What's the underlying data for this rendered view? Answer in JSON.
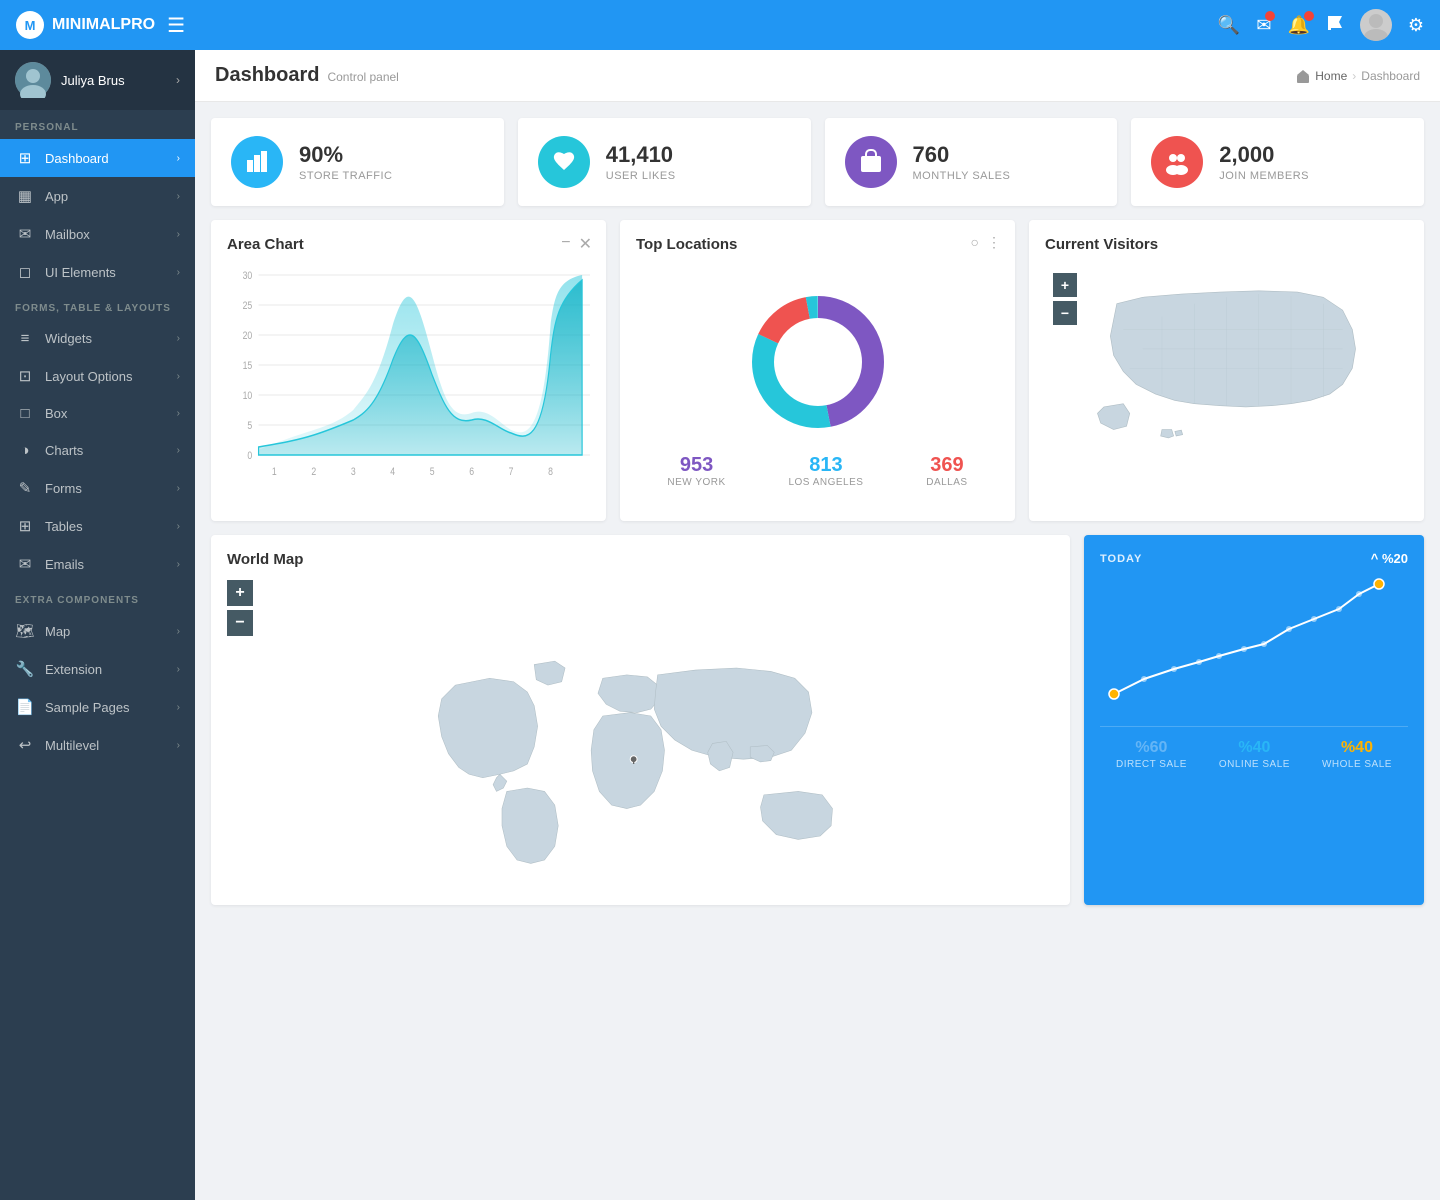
{
  "app": {
    "name": "MINIMALPRO",
    "hamburger": "☰"
  },
  "topnav": {
    "search_icon": "🔍",
    "mail_icon": "✉",
    "bell_icon": "🔔",
    "flag_icon": "⚑",
    "settings_icon": "⚙"
  },
  "sidebar": {
    "user_name": "Juliya Brus",
    "sections": [
      {
        "label": "PERSONAL",
        "items": [
          {
            "icon": "⊞",
            "label": "Dashboard",
            "active": true
          },
          {
            "icon": "▦",
            "label": "App",
            "active": false
          },
          {
            "icon": "✉",
            "label": "Mailbox",
            "active": false
          },
          {
            "icon": "◻",
            "label": "UI Elements",
            "active": false
          }
        ]
      },
      {
        "label": "FORMS, TABLE & LAYOUTS",
        "items": [
          {
            "icon": "≡",
            "label": "Widgets",
            "active": false
          },
          {
            "icon": "⊡",
            "label": "Layout Options",
            "active": false
          },
          {
            "icon": "□",
            "label": "Box",
            "active": false
          },
          {
            "icon": "◑",
            "label": "Charts",
            "active": false
          },
          {
            "icon": "✎",
            "label": "Forms",
            "active": false
          },
          {
            "icon": "⊞",
            "label": "Tables",
            "active": false
          },
          {
            "icon": "✉",
            "label": "Emails",
            "active": false
          }
        ]
      },
      {
        "label": "EXTRA COMPONENTS",
        "items": [
          {
            "icon": "🗺",
            "label": "Map",
            "active": false
          },
          {
            "icon": "🔧",
            "label": "Extension",
            "active": false
          },
          {
            "icon": "📄",
            "label": "Sample Pages",
            "active": false
          },
          {
            "icon": "↩",
            "label": "Multilevel",
            "active": false
          }
        ]
      }
    ]
  },
  "page_header": {
    "title": "Dashboard",
    "subtitle": "Control panel",
    "breadcrumb_home": "Home",
    "breadcrumb_current": "Dashboard"
  },
  "stats": [
    {
      "id": "traffic",
      "value": "90%",
      "label": "STORE TRAFFIC",
      "color": "#29b6f6",
      "icon": "📊"
    },
    {
      "id": "likes",
      "value": "41,410",
      "label": "USER LIKES",
      "color": "#26c6da",
      "icon": "👍"
    },
    {
      "id": "sales",
      "value": "760",
      "label": "MONTHLY SALES",
      "color": "#7e57c2",
      "icon": "🛒"
    },
    {
      "id": "members",
      "value": "2,000",
      "label": "JOIN MEMBERS",
      "color": "#ef5350",
      "icon": "👥"
    }
  ],
  "area_chart": {
    "title": "Area Chart",
    "y_labels": [
      "30",
      "25",
      "20",
      "15",
      "10",
      "5",
      "0"
    ],
    "x_labels": [
      "1",
      "2",
      "3",
      "4",
      "5",
      "6",
      "7",
      "8"
    ]
  },
  "top_locations": {
    "title": "Top Locations",
    "locations": [
      {
        "city": "New York",
        "value": "953",
        "color": "#7e57c2"
      },
      {
        "city": "Los Angeles",
        "value": "813",
        "color": "#29b6f6"
      },
      {
        "city": "Dallas",
        "value": "369",
        "color": "#ef5350"
      }
    ],
    "donut_segments": [
      {
        "label": "New York",
        "color": "#7e57c2",
        "percent": 47
      },
      {
        "label": "Los Angeles",
        "color": "#26c6da",
        "percent": 35
      },
      {
        "label": "Dallas",
        "color": "#ef5350",
        "percent": 18
      }
    ]
  },
  "current_visitors": {
    "title": "Current Visitors"
  },
  "world_map": {
    "title": "World Map"
  },
  "today": {
    "label": "TODAY",
    "percent": "^ %20",
    "stats": [
      {
        "value": "%60",
        "label": "DIRECT SALE",
        "color": "#64b5f6"
      },
      {
        "value": "%40",
        "label": "ONLINE SALE",
        "color": "#29b6f6"
      },
      {
        "value": "%40",
        "label": "WHOLE SALE",
        "color": "#ffb300"
      }
    ]
  }
}
